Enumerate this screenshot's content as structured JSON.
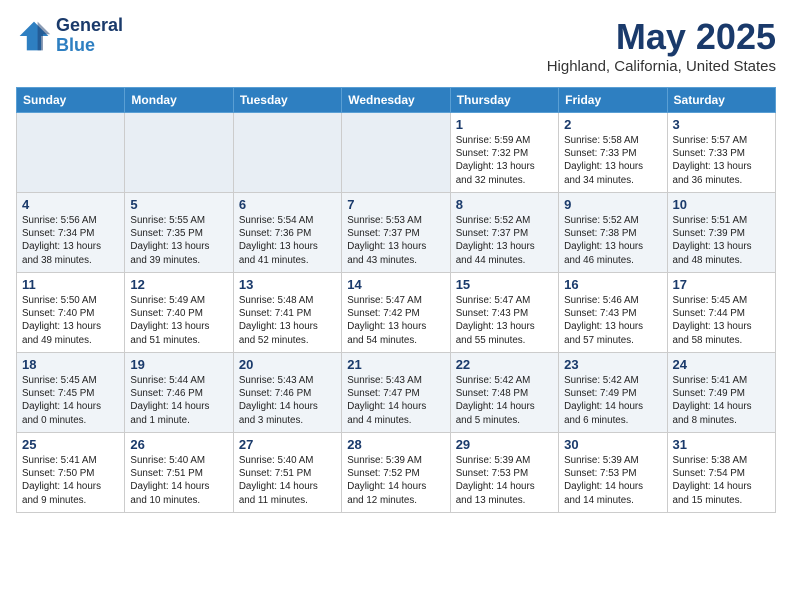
{
  "logo": {
    "line1": "General",
    "line2": "Blue"
  },
  "title": "May 2025",
  "subtitle": "Highland, California, United States",
  "days_of_week": [
    "Sunday",
    "Monday",
    "Tuesday",
    "Wednesday",
    "Thursday",
    "Friday",
    "Saturday"
  ],
  "weeks": [
    [
      {
        "day": "",
        "info": ""
      },
      {
        "day": "",
        "info": ""
      },
      {
        "day": "",
        "info": ""
      },
      {
        "day": "",
        "info": ""
      },
      {
        "day": "1",
        "info": "Sunrise: 5:59 AM\nSunset: 7:32 PM\nDaylight: 13 hours\nand 32 minutes."
      },
      {
        "day": "2",
        "info": "Sunrise: 5:58 AM\nSunset: 7:33 PM\nDaylight: 13 hours\nand 34 minutes."
      },
      {
        "day": "3",
        "info": "Sunrise: 5:57 AM\nSunset: 7:33 PM\nDaylight: 13 hours\nand 36 minutes."
      }
    ],
    [
      {
        "day": "4",
        "info": "Sunrise: 5:56 AM\nSunset: 7:34 PM\nDaylight: 13 hours\nand 38 minutes."
      },
      {
        "day": "5",
        "info": "Sunrise: 5:55 AM\nSunset: 7:35 PM\nDaylight: 13 hours\nand 39 minutes."
      },
      {
        "day": "6",
        "info": "Sunrise: 5:54 AM\nSunset: 7:36 PM\nDaylight: 13 hours\nand 41 minutes."
      },
      {
        "day": "7",
        "info": "Sunrise: 5:53 AM\nSunset: 7:37 PM\nDaylight: 13 hours\nand 43 minutes."
      },
      {
        "day": "8",
        "info": "Sunrise: 5:52 AM\nSunset: 7:37 PM\nDaylight: 13 hours\nand 44 minutes."
      },
      {
        "day": "9",
        "info": "Sunrise: 5:52 AM\nSunset: 7:38 PM\nDaylight: 13 hours\nand 46 minutes."
      },
      {
        "day": "10",
        "info": "Sunrise: 5:51 AM\nSunset: 7:39 PM\nDaylight: 13 hours\nand 48 minutes."
      }
    ],
    [
      {
        "day": "11",
        "info": "Sunrise: 5:50 AM\nSunset: 7:40 PM\nDaylight: 13 hours\nand 49 minutes."
      },
      {
        "day": "12",
        "info": "Sunrise: 5:49 AM\nSunset: 7:40 PM\nDaylight: 13 hours\nand 51 minutes."
      },
      {
        "day": "13",
        "info": "Sunrise: 5:48 AM\nSunset: 7:41 PM\nDaylight: 13 hours\nand 52 minutes."
      },
      {
        "day": "14",
        "info": "Sunrise: 5:47 AM\nSunset: 7:42 PM\nDaylight: 13 hours\nand 54 minutes."
      },
      {
        "day": "15",
        "info": "Sunrise: 5:47 AM\nSunset: 7:43 PM\nDaylight: 13 hours\nand 55 minutes."
      },
      {
        "day": "16",
        "info": "Sunrise: 5:46 AM\nSunset: 7:43 PM\nDaylight: 13 hours\nand 57 minutes."
      },
      {
        "day": "17",
        "info": "Sunrise: 5:45 AM\nSunset: 7:44 PM\nDaylight: 13 hours\nand 58 minutes."
      }
    ],
    [
      {
        "day": "18",
        "info": "Sunrise: 5:45 AM\nSunset: 7:45 PM\nDaylight: 14 hours\nand 0 minutes."
      },
      {
        "day": "19",
        "info": "Sunrise: 5:44 AM\nSunset: 7:46 PM\nDaylight: 14 hours\nand 1 minute."
      },
      {
        "day": "20",
        "info": "Sunrise: 5:43 AM\nSunset: 7:46 PM\nDaylight: 14 hours\nand 3 minutes."
      },
      {
        "day": "21",
        "info": "Sunrise: 5:43 AM\nSunset: 7:47 PM\nDaylight: 14 hours\nand 4 minutes."
      },
      {
        "day": "22",
        "info": "Sunrise: 5:42 AM\nSunset: 7:48 PM\nDaylight: 14 hours\nand 5 minutes."
      },
      {
        "day": "23",
        "info": "Sunrise: 5:42 AM\nSunset: 7:49 PM\nDaylight: 14 hours\nand 6 minutes."
      },
      {
        "day": "24",
        "info": "Sunrise: 5:41 AM\nSunset: 7:49 PM\nDaylight: 14 hours\nand 8 minutes."
      }
    ],
    [
      {
        "day": "25",
        "info": "Sunrise: 5:41 AM\nSunset: 7:50 PM\nDaylight: 14 hours\nand 9 minutes."
      },
      {
        "day": "26",
        "info": "Sunrise: 5:40 AM\nSunset: 7:51 PM\nDaylight: 14 hours\nand 10 minutes."
      },
      {
        "day": "27",
        "info": "Sunrise: 5:40 AM\nSunset: 7:51 PM\nDaylight: 14 hours\nand 11 minutes."
      },
      {
        "day": "28",
        "info": "Sunrise: 5:39 AM\nSunset: 7:52 PM\nDaylight: 14 hours\nand 12 minutes."
      },
      {
        "day": "29",
        "info": "Sunrise: 5:39 AM\nSunset: 7:53 PM\nDaylight: 14 hours\nand 13 minutes."
      },
      {
        "day": "30",
        "info": "Sunrise: 5:39 AM\nSunset: 7:53 PM\nDaylight: 14 hours\nand 14 minutes."
      },
      {
        "day": "31",
        "info": "Sunrise: 5:38 AM\nSunset: 7:54 PM\nDaylight: 14 hours\nand 15 minutes."
      }
    ]
  ]
}
